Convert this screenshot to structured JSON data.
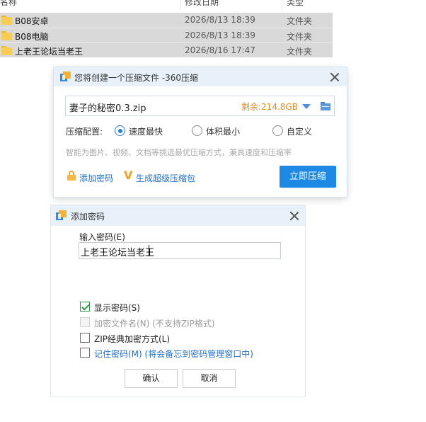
{
  "explorer": {
    "headers": {
      "name": "名称",
      "date": "修改日期",
      "type": "类型"
    },
    "rows": [
      {
        "name": "B08安卓",
        "date": "2026/8/13 18:39",
        "type": "文件夹",
        "icon": "folder-icon"
      },
      {
        "name": "B08电脑",
        "date": "2026/8/13 18:39",
        "type": "文件夹",
        "icon": "folder-icon"
      },
      {
        "name": "上老王论坛当老王",
        "date": "2026/8/16 17:47",
        "type": "文件夹",
        "icon": "folder-icon"
      }
    ],
    "row_bg": "#d9d9d9"
  },
  "compress_dialog": {
    "title": "您将创建一个压缩文件 -360压缩",
    "archive_name": "妻子的秘密0.3.zip",
    "free_space": "剩余:214.8GB",
    "config_label": "压缩配置:",
    "options": [
      {
        "label": "速度最快",
        "selected": true
      },
      {
        "label": "体积最小",
        "selected": false
      },
      {
        "label": "自定义",
        "selected": false
      }
    ],
    "hint": "智能为图片、视频、文档等挑选最优压缩方式，兼具速度和压缩率",
    "add_password": "添加密码",
    "super_package": "生成超级压缩包",
    "compress_now": "立即压缩",
    "accent": "#1e88e5",
    "free_color": "#e58a1c"
  },
  "password_dialog": {
    "title": "添加密码",
    "input_label": "输入密码(E)",
    "password_value": "上老王论坛当老王",
    "checkboxes": [
      {
        "label": "显示密码(S)",
        "note": "",
        "checked": true,
        "disabled": false
      },
      {
        "label": "加密文件名(N) (不支持ZIP格式)",
        "note": "",
        "checked": false,
        "disabled": true
      },
      {
        "label": "ZIP经典加密方式(L)",
        "note": "",
        "checked": false,
        "disabled": false
      },
      {
        "label": "记住密码(M)",
        "note": "(将会备忘到密码管理窗口中)",
        "checked": false,
        "disabled": false
      }
    ],
    "ok": "确认",
    "cancel": "取消"
  }
}
